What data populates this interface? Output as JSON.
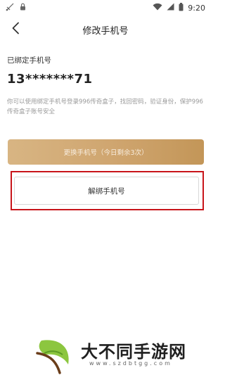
{
  "status_bar": {
    "time": "9:20",
    "icons": [
      "signal-icon",
      "lock-icon",
      "wifi-icon",
      "cellular-icon",
      "battery-icon"
    ]
  },
  "nav": {
    "back_icon": "chevron-left-icon",
    "title": "修改手机号"
  },
  "main": {
    "bound_label": "已绑定手机号",
    "phone_number": "13*******71",
    "description": "你可以使用绑定手机号登录996传奇盒子，找回密码，验证身份，保护996传奇盒子账号安全",
    "change_button_label": "更换手机号（今日剩余3次）",
    "unbind_button_label": "解绑手机号"
  },
  "watermark": {
    "brand": "大不同手游网",
    "url": "www.szdbtgg.com"
  },
  "colors": {
    "accent_gold": "#cfa56f",
    "highlight_red": "#c8141a",
    "logo_green": "#8cc63f"
  }
}
